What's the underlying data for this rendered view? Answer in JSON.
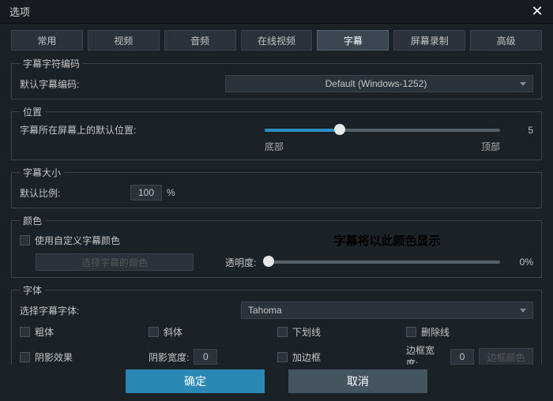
{
  "window": {
    "title": "选项"
  },
  "tabs": {
    "items": [
      "常用",
      "视频",
      "音频",
      "在线视频",
      "字幕",
      "屏幕录制",
      "高级"
    ],
    "activeIndex": 4
  },
  "encoding": {
    "legend": "字幕字符编码",
    "label": "默认字幕编码:",
    "value": "Default (Windows-1252)"
  },
  "position": {
    "legend": "位置",
    "label": "字幕所在屏幕上的默认位置:",
    "value": "5",
    "min_label": "底部",
    "max_label": "顶部",
    "percent": 32
  },
  "size": {
    "legend": "字幕大小",
    "label": "默认比例:",
    "value": "100",
    "suffix": "%"
  },
  "color": {
    "legend": "颜色",
    "use_custom_label": "使用自定义字幕颜色",
    "choose_btn": "选择字幕的颜色",
    "preview_text": "字幕将以此颜色显示",
    "opacity_label": "透明度:",
    "opacity_value": "0%",
    "opacity_percent": 0
  },
  "font": {
    "legend": "字体",
    "select_label": "选择字幕字体:",
    "value": "Tahoma",
    "bold": "粗体",
    "italic": "斜体",
    "underline": "下划线",
    "strike": "删除线",
    "shadow": "阴影效果",
    "shadow_width_label": "阴影宽度:",
    "shadow_width": "0",
    "border": "加边框",
    "border_width_label": "边框宽度:",
    "border_width": "0",
    "border_color_btn": "边框颜色"
  },
  "actions": {
    "ok": "确定",
    "cancel": "取消"
  }
}
